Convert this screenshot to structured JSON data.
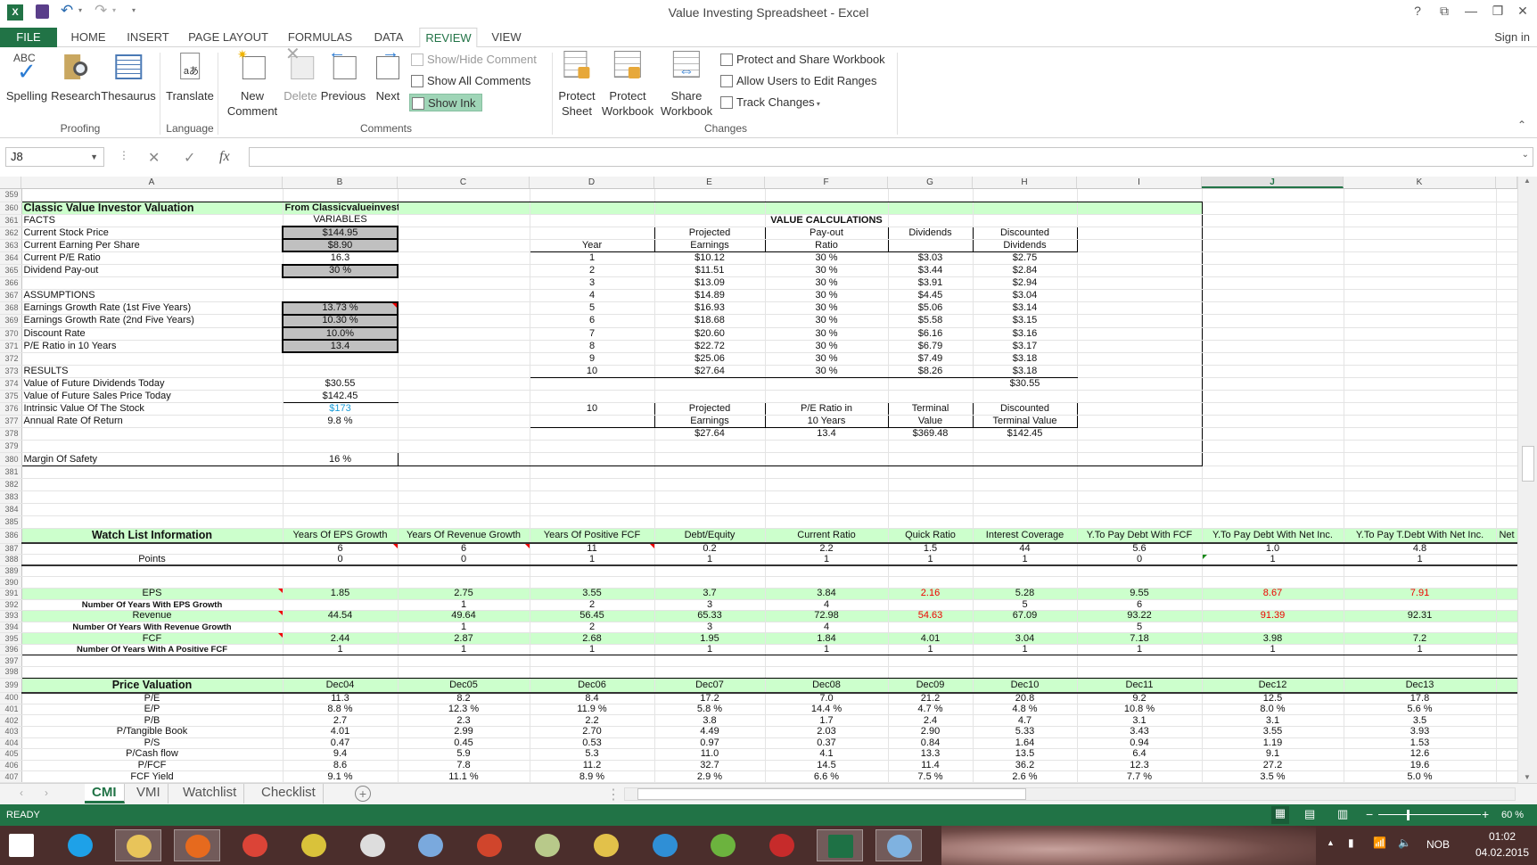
{
  "app": {
    "title": "Value Investing Spreadsheet - Excel",
    "sign_in": "Sign in",
    "help": "?"
  },
  "menu_tabs": [
    "FILE",
    "HOME",
    "INSERT",
    "PAGE LAYOUT",
    "FORMULAS",
    "DATA",
    "REVIEW",
    "VIEW"
  ],
  "active_tab": "REVIEW",
  "ribbon": {
    "spelling": "Spelling",
    "research": "Research",
    "thesaurus": "Thesaurus",
    "translate": "Translate",
    "new_comment_1": "New",
    "new_comment_2": "Comment",
    "delete": "Delete",
    "previous": "Previous",
    "next": "Next",
    "show_hide_comment": "Show/Hide Comment",
    "show_all_comments": "Show All Comments",
    "show_ink": "Show Ink",
    "protect_sheet_1": "Protect",
    "protect_sheet_2": "Sheet",
    "protect_workbook_1": "Protect",
    "protect_workbook_2": "Workbook",
    "share_workbook_1": "Share",
    "share_workbook_2": "Workbook",
    "protect_share": "Protect and Share Workbook",
    "allow_users": "Allow Users to Edit Ranges",
    "track_changes": "Track Changes",
    "abc": "ABC",
    "groups": {
      "proofing": "Proofing",
      "language": "Language",
      "comments": "Comments",
      "changes": "Changes"
    }
  },
  "name_box": "J8",
  "formula": "",
  "columns": [
    "A",
    "B",
    "C",
    "D",
    "E",
    "F",
    "G",
    "H",
    "I",
    "J",
    "K"
  ],
  "selected_column": "J",
  "rows": [
    {
      "n": "359",
      "c": []
    },
    {
      "n": "360",
      "c": [
        "Classic Value Investor Valuation",
        "From Classicvalueinvestors.com"
      ]
    },
    {
      "n": "361",
      "c": [
        "FACTS",
        "VARIABLES",
        "",
        "",
        "",
        "VALUE CALCULATIONS"
      ]
    },
    {
      "n": "362",
      "c": [
        "Current Stock Price",
        "$144.95",
        "",
        "",
        "Projected",
        "Pay-out",
        "Dividends",
        "Discounted"
      ]
    },
    {
      "n": "363",
      "c": [
        "Current Earning Per Share",
        "$8.90",
        "",
        "Year",
        "Earnings",
        "Ratio",
        "",
        "Dividends"
      ]
    },
    {
      "n": "364",
      "c": [
        "Current P/E Ratio",
        "16.3",
        "",
        "1",
        "$10.12",
        "30 %",
        "$3.03",
        "$2.75"
      ]
    },
    {
      "n": "365",
      "c": [
        "Dividend Pay-out",
        "30 %",
        "",
        "2",
        "$11.51",
        "30 %",
        "$3.44",
        "$2.84"
      ]
    },
    {
      "n": "366",
      "c": [
        "",
        "",
        "",
        "3",
        "$13.09",
        "30 %",
        "$3.91",
        "$2.94"
      ]
    },
    {
      "n": "367",
      "c": [
        "ASSUMPTIONS",
        "",
        "",
        "4",
        "$14.89",
        "30 %",
        "$4.45",
        "$3.04"
      ]
    },
    {
      "n": "368",
      "c": [
        "Earnings Growth Rate (1st Five Years)",
        "13.73 %",
        "",
        "5",
        "$16.93",
        "30 %",
        "$5.06",
        "$3.14"
      ]
    },
    {
      "n": "369",
      "c": [
        "Earnings Growth Rate (2nd Five Years)",
        "10.30 %",
        "",
        "6",
        "$18.68",
        "30 %",
        "$5.58",
        "$3.15"
      ]
    },
    {
      "n": "370",
      "c": [
        "Discount Rate",
        "10.0%",
        "",
        "7",
        "$20.60",
        "30 %",
        "$6.16",
        "$3.16"
      ]
    },
    {
      "n": "371",
      "c": [
        "P/E Ratio in 10 Years",
        "13.4",
        "",
        "8",
        "$22.72",
        "30 %",
        "$6.79",
        "$3.17"
      ]
    },
    {
      "n": "372",
      "c": [
        "",
        "",
        "",
        "9",
        "$25.06",
        "30 %",
        "$7.49",
        "$3.18"
      ]
    },
    {
      "n": "373",
      "c": [
        "RESULTS",
        "",
        "",
        "10",
        "$27.64",
        "30 %",
        "$8.26",
        "$3.18"
      ]
    },
    {
      "n": "374",
      "c": [
        "Value of Future Dividends Today",
        "$30.55",
        "",
        "",
        "",
        "",
        "",
        "$30.55"
      ]
    },
    {
      "n": "375",
      "c": [
        "Value of Future Sales Price Today",
        "$142.45"
      ]
    },
    {
      "n": "376",
      "c": [
        "Intrinsic Value Of The Stock",
        "$173",
        "",
        "10",
        "Projected",
        "P/E Ratio in",
        "Terminal",
        "Discounted"
      ]
    },
    {
      "n": "377",
      "c": [
        "Annual Rate Of Return",
        "9.8 %",
        "",
        "",
        "Earnings",
        "10 Years",
        "Value",
        "Terminal Value"
      ]
    },
    {
      "n": "378",
      "c": [
        "",
        "",
        "",
        "",
        "$27.64",
        "13.4",
        "$369.48",
        "$142.45"
      ]
    },
    {
      "n": "379",
      "c": []
    },
    {
      "n": "380",
      "c": [
        "Margin Of Safety",
        "16 %"
      ]
    },
    {
      "n": "381",
      "c": []
    },
    {
      "n": "382",
      "c": []
    },
    {
      "n": "383",
      "c": []
    },
    {
      "n": "384",
      "c": []
    },
    {
      "n": "385",
      "c": []
    },
    {
      "n": "386",
      "c": [
        "Watch List Information",
        "Years Of EPS Growth",
        "Years Of Revenue Growth",
        "Years Of Positive FCF",
        "Debt/Equity",
        "Current Ratio",
        "Quick Ratio",
        "Interest Coverage",
        "Y.To Pay Debt With FCF",
        "Y.To Pay Debt With Net Inc.",
        "Y.To Pay T.Debt With Net Inc.",
        "Net"
      ]
    },
    {
      "n": "387",
      "c": [
        "",
        "6",
        "6",
        "11",
        "0.2",
        "2.2",
        "1.5",
        "44",
        "5.6",
        "1.0",
        "4.8"
      ]
    },
    {
      "n": "388",
      "c": [
        "Points",
        "0",
        "0",
        "1",
        "1",
        "1",
        "1",
        "1",
        "0",
        "1",
        "1"
      ]
    },
    {
      "n": "389",
      "c": []
    },
    {
      "n": "390",
      "c": []
    },
    {
      "n": "391",
      "c": [
        "EPS",
        "1.85",
        "2.75",
        "3.55",
        "3.7",
        "3.84",
        "2.16",
        "5.28",
        "9.55",
        "8.67",
        "7.91"
      ]
    },
    {
      "n": "392",
      "c": [
        "Number Of Years With EPS Growth",
        "",
        "1",
        "2",
        "3",
        "4",
        "",
        "5",
        "6",
        "",
        ""
      ]
    },
    {
      "n": "393",
      "c": [
        "Revenue",
        "44.54",
        "49.64",
        "56.45",
        "65.33",
        "72.98",
        "54.63",
        "67.09",
        "93.22",
        "91.39",
        "92.31"
      ]
    },
    {
      "n": "394",
      "c": [
        "Number Of Years With Revenue Growth",
        "",
        "1",
        "2",
        "3",
        "4",
        "",
        "",
        "5",
        "",
        ""
      ]
    },
    {
      "n": "395",
      "c": [
        "FCF",
        "2.44",
        "2.87",
        "2.68",
        "1.95",
        "1.84",
        "4.01",
        "3.04",
        "7.18",
        "3.98",
        "7.2"
      ]
    },
    {
      "n": "396",
      "c": [
        "Number Of Years With A Positive FCF",
        "1",
        "1",
        "1",
        "1",
        "1",
        "1",
        "1",
        "1",
        "1",
        "1"
      ]
    },
    {
      "n": "397",
      "c": []
    },
    {
      "n": "398",
      "c": []
    },
    {
      "n": "399",
      "c": [
        "Price Valuation",
        "Dec04",
        "Dec05",
        "Dec06",
        "Dec07",
        "Dec08",
        "Dec09",
        "Dec10",
        "Dec11",
        "Dec12",
        "Dec13"
      ]
    },
    {
      "n": "400",
      "c": [
        "P/E",
        "11.3",
        "8.2",
        "8.4",
        "17.2",
        "7.0",
        "21.2",
        "20.8",
        "9.2",
        "12.5",
        "17.8"
      ]
    },
    {
      "n": "401",
      "c": [
        "E/P",
        "8.8 %",
        "12.3 %",
        "11.9 %",
        "5.8 %",
        "14.4 %",
        "4.7 %",
        "4.8 %",
        "10.8 %",
        "8.0 %",
        "5.6 %"
      ]
    },
    {
      "n": "402",
      "c": [
        "P/B",
        "2.7",
        "2.3",
        "2.2",
        "3.8",
        "1.7",
        "2.4",
        "4.7",
        "3.1",
        "3.1",
        "3.5"
      ]
    },
    {
      "n": "403",
      "c": [
        "P/Tangible Book",
        "4.01",
        "2.99",
        "2.70",
        "4.49",
        "2.03",
        "2.90",
        "5.33",
        "3.43",
        "3.55",
        "3.93"
      ]
    },
    {
      "n": "404",
      "c": [
        "P/S",
        "0.47",
        "0.45",
        "0.53",
        "0.97",
        "0.37",
        "0.84",
        "1.64",
        "0.94",
        "1.19",
        "1.53"
      ]
    },
    {
      "n": "405",
      "c": [
        "P/Cash flow",
        "9.4",
        "5.9",
        "5.3",
        "11.0",
        "4.1",
        "13.3",
        "13.5",
        "6.4",
        "9.1",
        "12.6"
      ]
    },
    {
      "n": "406",
      "c": [
        "P/FCF",
        "8.6",
        "7.8",
        "11.2",
        "32.7",
        "14.5",
        "11.4",
        "36.2",
        "12.3",
        "27.2",
        "19.6"
      ]
    },
    {
      "n": "407",
      "c": [
        "FCF Yield",
        "9.1 %",
        "11.1 %",
        "8.9 %",
        "2.9 %",
        "6.6 %",
        "7.5 %",
        "2.6 %",
        "7.7 %",
        "3.5 %",
        "5.0 %"
      ]
    }
  ],
  "sheet_tabs": [
    "CMI",
    "VMI",
    "Watchlist",
    "Checklist"
  ],
  "active_sheet": "CMI",
  "status": {
    "text": "READY",
    "zoom": "60 %",
    "zoom_percent": 60
  },
  "colors": {
    "excel_green": "#217346",
    "highlight_green": "#ccffcc",
    "negative_red": "#ee0000",
    "intrinsic_blue": "#1a9bd7",
    "input_gray": "#c0c0c0"
  },
  "taskbar": {
    "apps": [
      "windows-start-icon",
      "internet-explorer-icon",
      "file-explorer-icon",
      "firefox-icon",
      "chrome-icon",
      "app-icon",
      "owl-app-icon",
      "search-app-icon",
      "ccleaner-icon",
      "notepad-icon",
      "chart-app-icon",
      "browser-app-icon",
      "utorrent-icon",
      "app-11-icon",
      "excel-icon",
      "paint-icon"
    ],
    "lang": "NOB",
    "time": "01:02",
    "date": "04.02.2015"
  }
}
